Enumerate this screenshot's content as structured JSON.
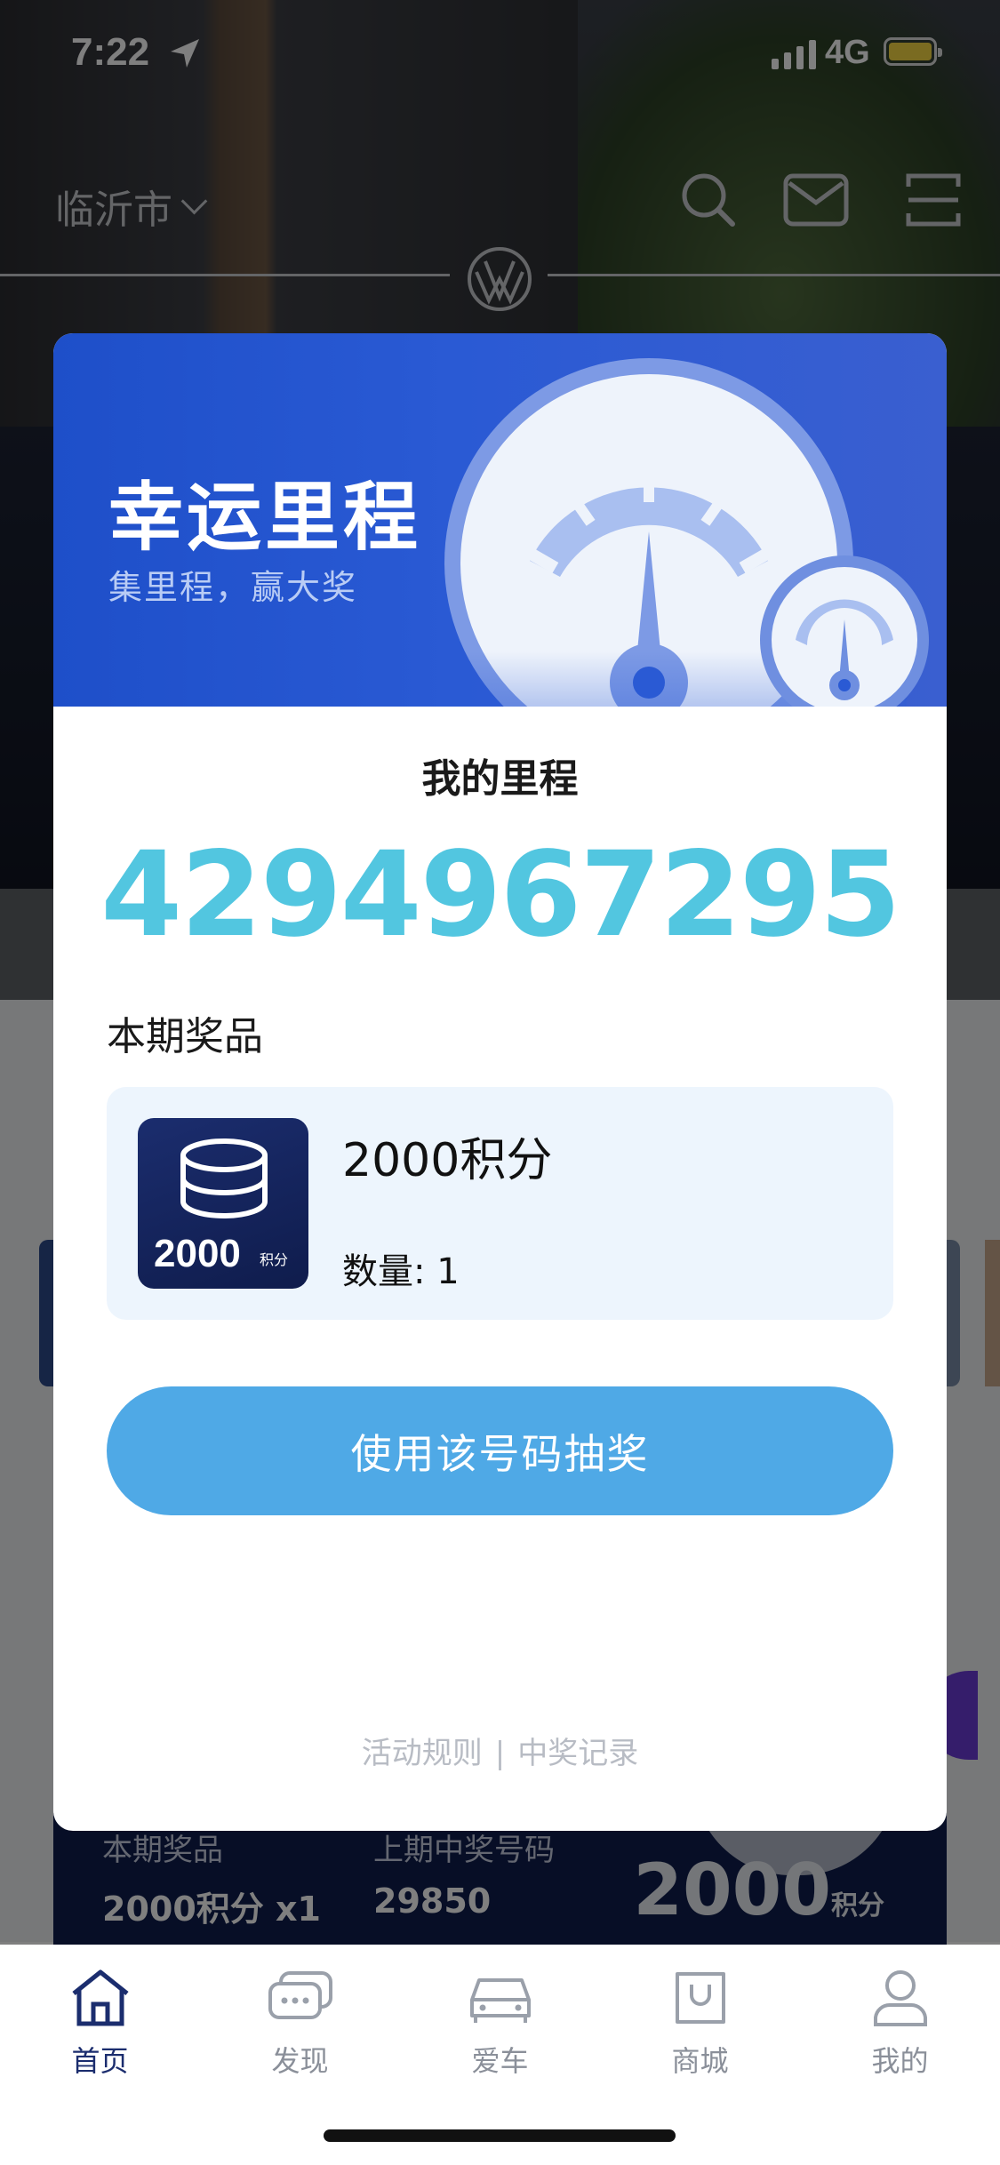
{
  "status_bar": {
    "time": "7:22",
    "network": "4G"
  },
  "top_nav": {
    "city": "临沂市"
  },
  "background_banner": {
    "prize_label": "本期奖品",
    "prize_value": "2000积分 x1",
    "last_winner_label": "上期中奖号码",
    "last_winner_value": "29850",
    "big_amount": "2000",
    "big_unit": "积分"
  },
  "modal": {
    "title": "幸运里程",
    "subtitle": "集里程，赢大奖",
    "mileage_label": "我的里程",
    "mileage_value": "4294967295",
    "prize_heading": "本期奖品",
    "prize": {
      "thumb_amount": "2000",
      "thumb_unit": "积分",
      "name": "2000积分",
      "quantity": "数量: 1"
    },
    "draw_button": "使用该号码抽奖",
    "links": {
      "rules": "活动规则",
      "separator": "|",
      "records": "中奖记录"
    }
  },
  "tabs": [
    {
      "label": "首页",
      "icon": "home-icon",
      "active": true
    },
    {
      "label": "发现",
      "icon": "chat-icon",
      "active": false
    },
    {
      "label": "爱车",
      "icon": "car-icon",
      "active": false
    },
    {
      "label": "商城",
      "icon": "shopping-bag-icon",
      "active": false
    },
    {
      "label": "我的",
      "icon": "profile-icon",
      "active": false
    }
  ],
  "colors": {
    "modal_header": "#1e4fc9",
    "mileage_number": "#52c6e0",
    "draw_button": "#4fa9e6",
    "tab_active": "#1b2d6e"
  }
}
